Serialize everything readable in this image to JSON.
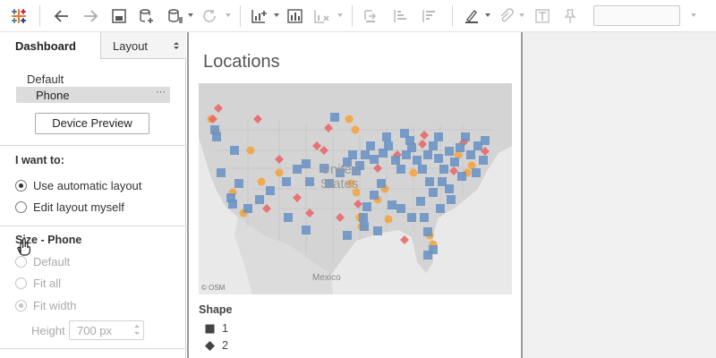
{
  "toolbar": {
    "icons": [
      "tableau-logo-icon",
      "undo-icon",
      "redo-icon",
      "save-icon",
      "new-data-source-icon",
      "pause-updates-icon",
      "refresh-icon",
      "new-worksheet-icon",
      "duplicate-icon",
      "clear-icon",
      "swap-icon",
      "sort-ascending-icon",
      "sort-descending-icon",
      "highlight-icon",
      "group-icon",
      "label-icon",
      "fix-axes-icon",
      "show-me-select"
    ],
    "accent": "#e8762d"
  },
  "left": {
    "tabs": {
      "dashboard": "Dashboard",
      "layout": "Layout"
    },
    "devices": {
      "default": "Default",
      "phone": "Phone",
      "more": "···"
    },
    "device_preview": "Device Preview",
    "i_want_to": {
      "title": "I want to:",
      "options": [
        "Use automatic layout",
        "Edit layout myself"
      ],
      "selected": 0
    },
    "size": {
      "title": "Size - Phone",
      "options": [
        "Default",
        "Fit all",
        "Fit width"
      ],
      "selected": 2,
      "height_label": "Height",
      "height_value": "700 px"
    }
  },
  "dashboard": {
    "title": "Locations",
    "map": {
      "country_label": "United States",
      "country_label_line1": "United",
      "country_label_line2": "States",
      "mexico_label": "Mexico",
      "attribution": "© OSM",
      "colors": {
        "square": "#6a93c4",
        "diamond": "#e8696b",
        "circle": "#f4a444"
      }
    },
    "legend": {
      "title": "Shape",
      "items": [
        {
          "label": "1",
          "shape": "square"
        },
        {
          "label": "2",
          "shape": "diamond"
        }
      ]
    }
  }
}
